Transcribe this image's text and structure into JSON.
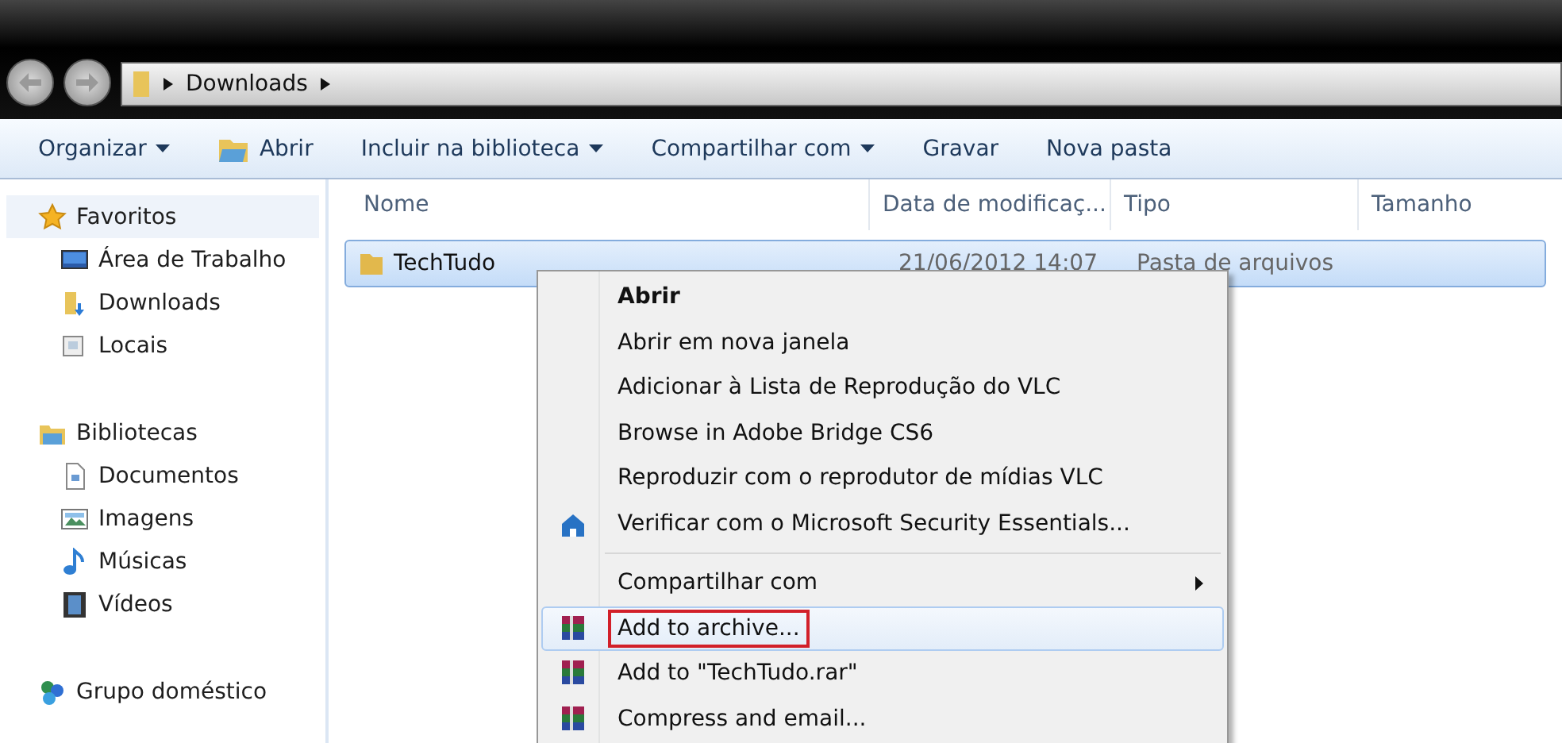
{
  "address_bar": {
    "path": [
      "Downloads"
    ]
  },
  "toolbar": [
    {
      "label": "Organizar",
      "dropdown": true,
      "kind": "plain"
    },
    {
      "label": "Abrir",
      "dropdown": false,
      "kind": "open"
    },
    {
      "label": "Incluir na biblioteca",
      "dropdown": true,
      "kind": "plain"
    },
    {
      "label": "Compartilhar com",
      "dropdown": true,
      "kind": "plain"
    },
    {
      "label": "Gravar",
      "dropdown": false,
      "kind": "plain"
    },
    {
      "label": "Nova pasta",
      "dropdown": false,
      "kind": "plain"
    }
  ],
  "sidebar": {
    "groups": [
      {
        "label": "Favoritos",
        "kind": "star",
        "selected": true,
        "children": [
          {
            "label": "Área de Trabalho",
            "kind": "desktop",
            "selected": false
          },
          {
            "label": "Downloads",
            "kind": "downloads",
            "selected": false
          },
          {
            "label": "Locais",
            "kind": "places",
            "selected": false
          }
        ]
      },
      {
        "label": "Bibliotecas",
        "kind": "library",
        "selected": false,
        "children": [
          {
            "label": "Documentos",
            "kind": "documents",
            "selected": false
          },
          {
            "label": "Imagens",
            "kind": "images",
            "selected": false
          },
          {
            "label": "Músicas",
            "kind": "music",
            "selected": false
          },
          {
            "label": "Vídeos",
            "kind": "videos",
            "selected": false
          }
        ]
      },
      {
        "label": "Grupo doméstico",
        "kind": "homegroup",
        "selected": false
      }
    ]
  },
  "table": {
    "columns": [
      "Nome",
      "Data de modificaç...",
      "Tipo",
      "Tamanho"
    ],
    "rows": [
      {
        "name": "TechTudo",
        "date": "21/06/2012 14:07",
        "type": "Pasta de arquivos",
        "selected": true
      }
    ]
  },
  "context_menu": {
    "items": [
      {
        "kind": "plain",
        "label": "Abrir",
        "default": true,
        "submenu": false,
        "selected": false,
        "outlined": false
      },
      {
        "kind": "plain",
        "label": "Abrir em nova janela",
        "default": false,
        "submenu": false,
        "selected": false,
        "outlined": false
      },
      {
        "kind": "plain",
        "label": "Adicionar à Lista de Reprodução do VLC",
        "default": false,
        "submenu": false,
        "selected": false,
        "outlined": false
      },
      {
        "kind": "plain",
        "label": "Browse in Adobe Bridge CS6",
        "default": false,
        "submenu": false,
        "selected": false,
        "outlined": false
      },
      {
        "kind": "plain",
        "label": "Reproduzir com o reprodutor de mídias VLC",
        "default": false,
        "submenu": false,
        "selected": false,
        "outlined": false
      },
      {
        "kind": "shield",
        "label": "Verificar com o Microsoft Security Essentials...",
        "default": false,
        "submenu": false,
        "selected": false,
        "outlined": false
      },
      {
        "kind": "separator"
      },
      {
        "kind": "plain",
        "label": "Compartilhar com",
        "default": false,
        "submenu": true,
        "selected": false,
        "outlined": false
      },
      {
        "kind": "archive",
        "label": "Add to archive...",
        "default": false,
        "submenu": false,
        "selected": true,
        "outlined": true
      },
      {
        "kind": "archive",
        "label": "Add to \"TechTudo.rar\"",
        "default": false,
        "submenu": false,
        "selected": false,
        "outlined": false
      },
      {
        "kind": "archive",
        "label": "Compress and email...",
        "default": false,
        "submenu": false,
        "selected": false,
        "outlined": false
      }
    ]
  }
}
